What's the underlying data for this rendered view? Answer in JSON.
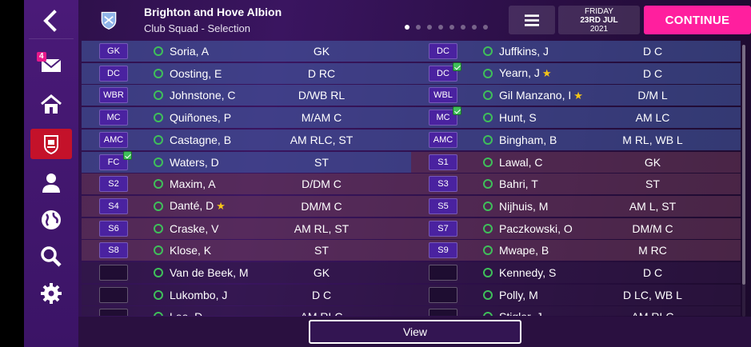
{
  "header": {
    "club_name": "Brighton and Hove Albion",
    "subtitle": "Club Squad - Selection",
    "date_day": "FRIDAY",
    "date_main": "23RD JUL",
    "date_year": "2021",
    "continue_label": "CONTINUE",
    "page_dots": 8,
    "active_dot": 0
  },
  "sidebar": {
    "inbox_badge": "4",
    "items": [
      "back-icon",
      "inbox-icon",
      "home-icon",
      "club-icon",
      "people-icon",
      "globe-icon",
      "search-icon",
      "gear-icon"
    ]
  },
  "rows": [
    {
      "left": {
        "pos": "GK",
        "name": "Soria, A",
        "role": "GK"
      },
      "right": {
        "pos": "DC",
        "name": "Juffkins, J",
        "role": "D C"
      }
    },
    {
      "left": {
        "pos": "DC",
        "name": "Oosting, E",
        "role": "D RC"
      },
      "right": {
        "pos": "DC",
        "name": "Yearn, J",
        "role": "D C",
        "tick": true,
        "star": true
      }
    },
    {
      "left": {
        "pos": "WBR",
        "name": "Johnstone, C",
        "role": "D/WB RL"
      },
      "right": {
        "pos": "WBL",
        "name": "Gil Manzano, I",
        "role": "D/M L",
        "star": true
      }
    },
    {
      "left": {
        "pos": "MC",
        "name": "Quiñones, P",
        "role": "M/AM C"
      },
      "right": {
        "pos": "MC",
        "name": "Hunt, S",
        "role": "AM LC",
        "tick": true
      }
    },
    {
      "left": {
        "pos": "AMC",
        "name": "Castagne, B",
        "role": "AM RLC, ST"
      },
      "right": {
        "pos": "AMC",
        "name": "Bingham, B",
        "role": "M RL, WB L"
      }
    },
    {
      "left": {
        "pos": "FC",
        "name": "Waters, D",
        "role": "ST",
        "tick": true
      },
      "right": {
        "pos": "S1",
        "name": "Lawal, C",
        "role": "GK"
      }
    },
    {
      "left": {
        "pos": "S2",
        "name": "Maxim, A",
        "role": "D/DM C"
      },
      "right": {
        "pos": "S3",
        "name": "Bahri, T",
        "role": "ST"
      }
    },
    {
      "left": {
        "pos": "S4",
        "name": "Danté, D",
        "role": "DM/M C",
        "star": true
      },
      "right": {
        "pos": "S5",
        "name": "Nijhuis, M",
        "role": "AM L, ST"
      }
    },
    {
      "left": {
        "pos": "S6",
        "name": "Craske, V",
        "role": "AM RL, ST"
      },
      "right": {
        "pos": "S7",
        "name": "Paczkowski, O",
        "role": "DM/M C"
      }
    },
    {
      "left": {
        "pos": "S8",
        "name": "Klose, K",
        "role": "ST"
      },
      "right": {
        "pos": "S9",
        "name": "Mwape, B",
        "role": "M RC"
      }
    },
    {
      "left": {
        "pos": "",
        "name": "Van de Beek, M",
        "role": "GK"
      },
      "right": {
        "pos": "",
        "name": "Kennedy, S",
        "role": "D C"
      }
    },
    {
      "left": {
        "pos": "",
        "name": "Lukombo, J",
        "role": "D C"
      },
      "right": {
        "pos": "",
        "name": "Polly, M",
        "role": "D LC, WB L"
      }
    },
    {
      "left": {
        "pos": "",
        "name": "Lee, D",
        "role": "AM RLC"
      },
      "right": {
        "pos": "",
        "name": "Stigler, J",
        "role": "AM RLC"
      }
    }
  ],
  "bottom": {
    "view_label": "View"
  }
}
